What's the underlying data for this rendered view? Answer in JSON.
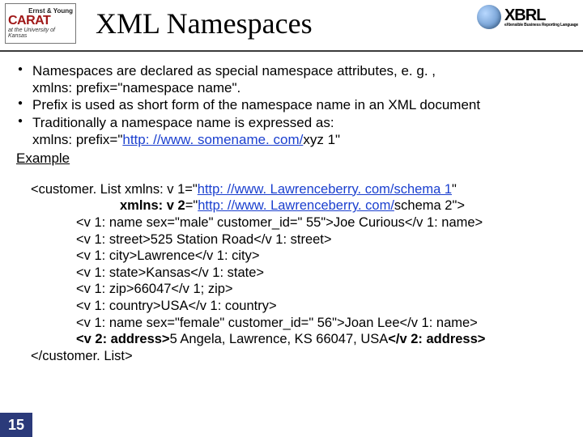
{
  "header": {
    "logo_left": {
      "ey": "Ernst & Young",
      "carat": "CARAT",
      "sub": "at the University of Kansas"
    },
    "title": "XML Namespaces",
    "logo_right": {
      "main": "XBRL",
      "sub": "eXtensible Business Reporting Language"
    }
  },
  "bullets": {
    "b1a": "Namespaces are declared as special namespace attributes, e. g. ,",
    "b1b": "xmlns: prefix=\"namespace name\".",
    "b2": "Prefix is used as short form of the namespace name in an XML document",
    "b3a": "Traditionally a namespace name is expressed as:",
    "b3b_pre": "xmlns: prefix=\"",
    "b3b_link": "http: //www. somename. com/",
    "b3b_post": "xyz 1\""
  },
  "example_label": "Example",
  "code": {
    "l1_pre": "<customer. List xmlns: v 1=\"",
    "l1_link": "http: //www. Lawrenceberry. com/schema 1",
    "l1_post": "\"",
    "l2_bold": "xmlns: v 2",
    "l2_mid": "=\"",
    "l2_link": "http: //www. Lawrenceberry. com/",
    "l2_post": "schema 2\">",
    "l3": "<v 1: name sex=\"male\" customer_id=\" 55\">Joe Curious</v 1: name>",
    "l4": "<v 1: street>525 Station Road</v 1: street>",
    "l5": "<v 1: city>Lawrence</v 1: city>",
    "l6": "<v 1: state>Kansas</v 1: state>",
    "l7": "<v 1: zip>66047</v 1; zip>",
    "l8": "<v 1: country>USA</v 1: country>",
    "l9": "<v 1: name sex=\"female\" customer_id=\" 56\">Joan Lee</v 1: name>",
    "l10_open": "<v 2: address>",
    "l10_mid": "5 Angela, Lawrence, KS 66047, USA",
    "l10_close": "</v 2: address>",
    "l11": "</customer. List>"
  },
  "slide_number": "15"
}
